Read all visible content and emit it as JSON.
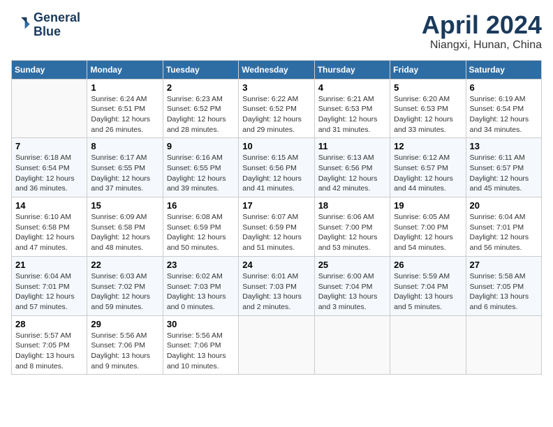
{
  "header": {
    "logo_line1": "General",
    "logo_line2": "Blue",
    "month": "April 2024",
    "location": "Niangxi, Hunan, China"
  },
  "days_of_week": [
    "Sunday",
    "Monday",
    "Tuesday",
    "Wednesday",
    "Thursday",
    "Friday",
    "Saturday"
  ],
  "weeks": [
    [
      {
        "day": "",
        "info": ""
      },
      {
        "day": "1",
        "info": "Sunrise: 6:24 AM\nSunset: 6:51 PM\nDaylight: 12 hours\nand 26 minutes."
      },
      {
        "day": "2",
        "info": "Sunrise: 6:23 AM\nSunset: 6:52 PM\nDaylight: 12 hours\nand 28 minutes."
      },
      {
        "day": "3",
        "info": "Sunrise: 6:22 AM\nSunset: 6:52 PM\nDaylight: 12 hours\nand 29 minutes."
      },
      {
        "day": "4",
        "info": "Sunrise: 6:21 AM\nSunset: 6:53 PM\nDaylight: 12 hours\nand 31 minutes."
      },
      {
        "day": "5",
        "info": "Sunrise: 6:20 AM\nSunset: 6:53 PM\nDaylight: 12 hours\nand 33 minutes."
      },
      {
        "day": "6",
        "info": "Sunrise: 6:19 AM\nSunset: 6:54 PM\nDaylight: 12 hours\nand 34 minutes."
      }
    ],
    [
      {
        "day": "7",
        "info": "Sunrise: 6:18 AM\nSunset: 6:54 PM\nDaylight: 12 hours\nand 36 minutes."
      },
      {
        "day": "8",
        "info": "Sunrise: 6:17 AM\nSunset: 6:55 PM\nDaylight: 12 hours\nand 37 minutes."
      },
      {
        "day": "9",
        "info": "Sunrise: 6:16 AM\nSunset: 6:55 PM\nDaylight: 12 hours\nand 39 minutes."
      },
      {
        "day": "10",
        "info": "Sunrise: 6:15 AM\nSunset: 6:56 PM\nDaylight: 12 hours\nand 41 minutes."
      },
      {
        "day": "11",
        "info": "Sunrise: 6:13 AM\nSunset: 6:56 PM\nDaylight: 12 hours\nand 42 minutes."
      },
      {
        "day": "12",
        "info": "Sunrise: 6:12 AM\nSunset: 6:57 PM\nDaylight: 12 hours\nand 44 minutes."
      },
      {
        "day": "13",
        "info": "Sunrise: 6:11 AM\nSunset: 6:57 PM\nDaylight: 12 hours\nand 45 minutes."
      }
    ],
    [
      {
        "day": "14",
        "info": "Sunrise: 6:10 AM\nSunset: 6:58 PM\nDaylight: 12 hours\nand 47 minutes."
      },
      {
        "day": "15",
        "info": "Sunrise: 6:09 AM\nSunset: 6:58 PM\nDaylight: 12 hours\nand 48 minutes."
      },
      {
        "day": "16",
        "info": "Sunrise: 6:08 AM\nSunset: 6:59 PM\nDaylight: 12 hours\nand 50 minutes."
      },
      {
        "day": "17",
        "info": "Sunrise: 6:07 AM\nSunset: 6:59 PM\nDaylight: 12 hours\nand 51 minutes."
      },
      {
        "day": "18",
        "info": "Sunrise: 6:06 AM\nSunset: 7:00 PM\nDaylight: 12 hours\nand 53 minutes."
      },
      {
        "day": "19",
        "info": "Sunrise: 6:05 AM\nSunset: 7:00 PM\nDaylight: 12 hours\nand 54 minutes."
      },
      {
        "day": "20",
        "info": "Sunrise: 6:04 AM\nSunset: 7:01 PM\nDaylight: 12 hours\nand 56 minutes."
      }
    ],
    [
      {
        "day": "21",
        "info": "Sunrise: 6:04 AM\nSunset: 7:01 PM\nDaylight: 12 hours\nand 57 minutes."
      },
      {
        "day": "22",
        "info": "Sunrise: 6:03 AM\nSunset: 7:02 PM\nDaylight: 12 hours\nand 59 minutes."
      },
      {
        "day": "23",
        "info": "Sunrise: 6:02 AM\nSunset: 7:03 PM\nDaylight: 13 hours\nand 0 minutes."
      },
      {
        "day": "24",
        "info": "Sunrise: 6:01 AM\nSunset: 7:03 PM\nDaylight: 13 hours\nand 2 minutes."
      },
      {
        "day": "25",
        "info": "Sunrise: 6:00 AM\nSunset: 7:04 PM\nDaylight: 13 hours\nand 3 minutes."
      },
      {
        "day": "26",
        "info": "Sunrise: 5:59 AM\nSunset: 7:04 PM\nDaylight: 13 hours\nand 5 minutes."
      },
      {
        "day": "27",
        "info": "Sunrise: 5:58 AM\nSunset: 7:05 PM\nDaylight: 13 hours\nand 6 minutes."
      }
    ],
    [
      {
        "day": "28",
        "info": "Sunrise: 5:57 AM\nSunset: 7:05 PM\nDaylight: 13 hours\nand 8 minutes."
      },
      {
        "day": "29",
        "info": "Sunrise: 5:56 AM\nSunset: 7:06 PM\nDaylight: 13 hours\nand 9 minutes."
      },
      {
        "day": "30",
        "info": "Sunrise: 5:56 AM\nSunset: 7:06 PM\nDaylight: 13 hours\nand 10 minutes."
      },
      {
        "day": "",
        "info": ""
      },
      {
        "day": "",
        "info": ""
      },
      {
        "day": "",
        "info": ""
      },
      {
        "day": "",
        "info": ""
      }
    ]
  ]
}
